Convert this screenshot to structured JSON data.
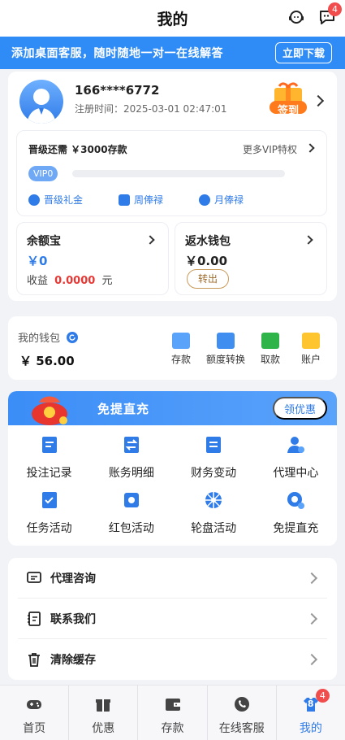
{
  "header": {
    "title": "我的",
    "message_badge": "4"
  },
  "banner": {
    "text": "添加桌面客服，随时随地一对一在线解答",
    "button": "立即下载"
  },
  "profile": {
    "phone": "166****6772",
    "register_time": "注册时间：2025-03-01 02:47:01",
    "signin_label": "签到"
  },
  "vip": {
    "need_text": "晋级还需 ￥3000存款",
    "more_text": "更多VIP特权",
    "level": "VIP0",
    "progress": 0,
    "links": [
      "晋级礼金",
      "周俸禄",
      "月俸禄"
    ]
  },
  "yuebao": {
    "title": "余额宝",
    "amount": "￥0",
    "income_label": "收益",
    "income_value": "0.0000",
    "income_unit": "元"
  },
  "rebate": {
    "title": "返水钱包",
    "amount": "￥0.00",
    "transfer_label": "转出"
  },
  "wallet": {
    "label": "我的钱包",
    "amount": "￥ 56.00",
    "actions": [
      "存款",
      "额度转换",
      "取款",
      "账户"
    ]
  },
  "promo": {
    "title": "免提直充",
    "button": "领优惠",
    "items": [
      "投注记录",
      "账务明细",
      "财务变动",
      "代理中心",
      "任务活动",
      "红包活动",
      "轮盘活动",
      "免提直充"
    ]
  },
  "menu": {
    "items": [
      "代理咨询",
      "联系我们",
      "清除缓存"
    ]
  },
  "tabbar": {
    "items": [
      "首页",
      "优惠",
      "存款",
      "在线客服",
      "我的"
    ],
    "active": "我的",
    "mine_badge": "4",
    "mine_count": "8"
  },
  "colors": {
    "accent": "#2f7be8",
    "banner": "#2f8cf6",
    "income_red": "#e53935",
    "badge": "#f24d4d"
  }
}
